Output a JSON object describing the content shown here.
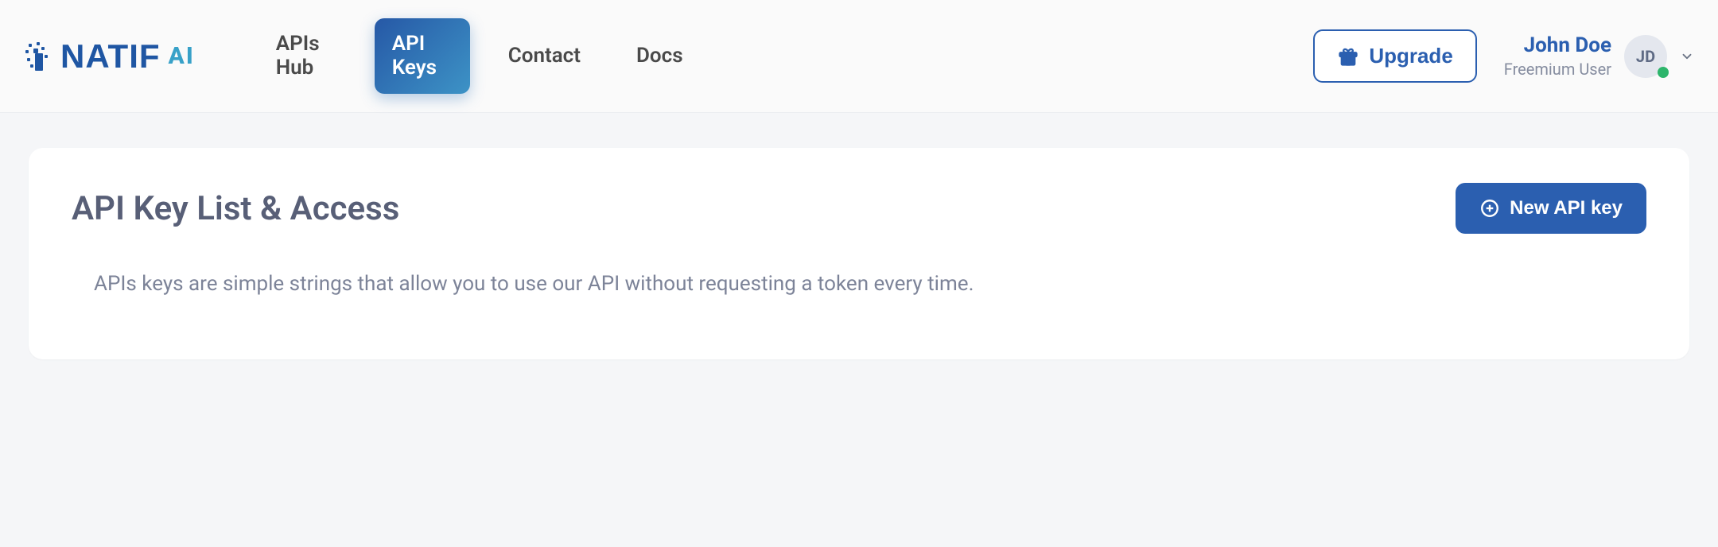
{
  "logo": {
    "text_primary": "NATIF",
    "text_secondary": "AI"
  },
  "nav": {
    "items": [
      {
        "label": "APIs Hub",
        "active": false,
        "multi": true
      },
      {
        "label": "API Keys",
        "active": true,
        "multi": true
      },
      {
        "label": "Contact",
        "active": false,
        "multi": false
      },
      {
        "label": "Docs",
        "active": false,
        "multi": false
      }
    ]
  },
  "header": {
    "upgrade_label": "Upgrade"
  },
  "user": {
    "name": "John Doe",
    "role": "Freemium User",
    "initials": "JD"
  },
  "main": {
    "title": "API Key List & Access",
    "description": "APIs keys are simple strings that allow you to use our API without requesting a token every time.",
    "new_key_label": "New API key"
  }
}
